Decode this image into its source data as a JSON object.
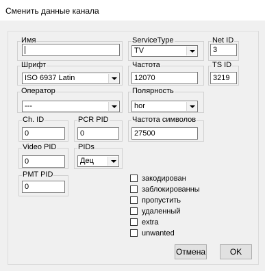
{
  "window": {
    "title": "Сменить данные канала"
  },
  "fields": {
    "name": {
      "label": "Имя",
      "value": ""
    },
    "service_type": {
      "label": "ServiceType",
      "value": "TV"
    },
    "net_id": {
      "label": "Net ID",
      "value": "3"
    },
    "font": {
      "label": "Шрифт",
      "value": "ISO 6937 Latin"
    },
    "frequency": {
      "label": "Частота",
      "value": "12070"
    },
    "ts_id": {
      "label": "TS ID",
      "value": "3219"
    },
    "operator": {
      "label": "Оператор",
      "value": "---"
    },
    "polarity": {
      "label": "Полярность",
      "value": "hor"
    },
    "ch_id": {
      "label": "Ch. ID",
      "value": "0"
    },
    "pcr_pid": {
      "label": "PCR PID",
      "value": "0"
    },
    "symbol_rate": {
      "label": "Частота символов",
      "value": "27500"
    },
    "video_pid": {
      "label": "Video PID",
      "value": "0"
    },
    "pids": {
      "label": "PIDs",
      "value": "Дец"
    },
    "pmt_pid": {
      "label": "PMT PID",
      "value": "0"
    }
  },
  "flags": [
    {
      "label": "закодирован",
      "checked": false
    },
    {
      "label": "заблокированны",
      "checked": false
    },
    {
      "label": "пропустить",
      "checked": false
    },
    {
      "label": "удаленный",
      "checked": false
    },
    {
      "label": "extra",
      "checked": false
    },
    {
      "label": "unwanted",
      "checked": false
    }
  ],
  "buttons": {
    "cancel": "Отмена",
    "ok": "OK"
  }
}
